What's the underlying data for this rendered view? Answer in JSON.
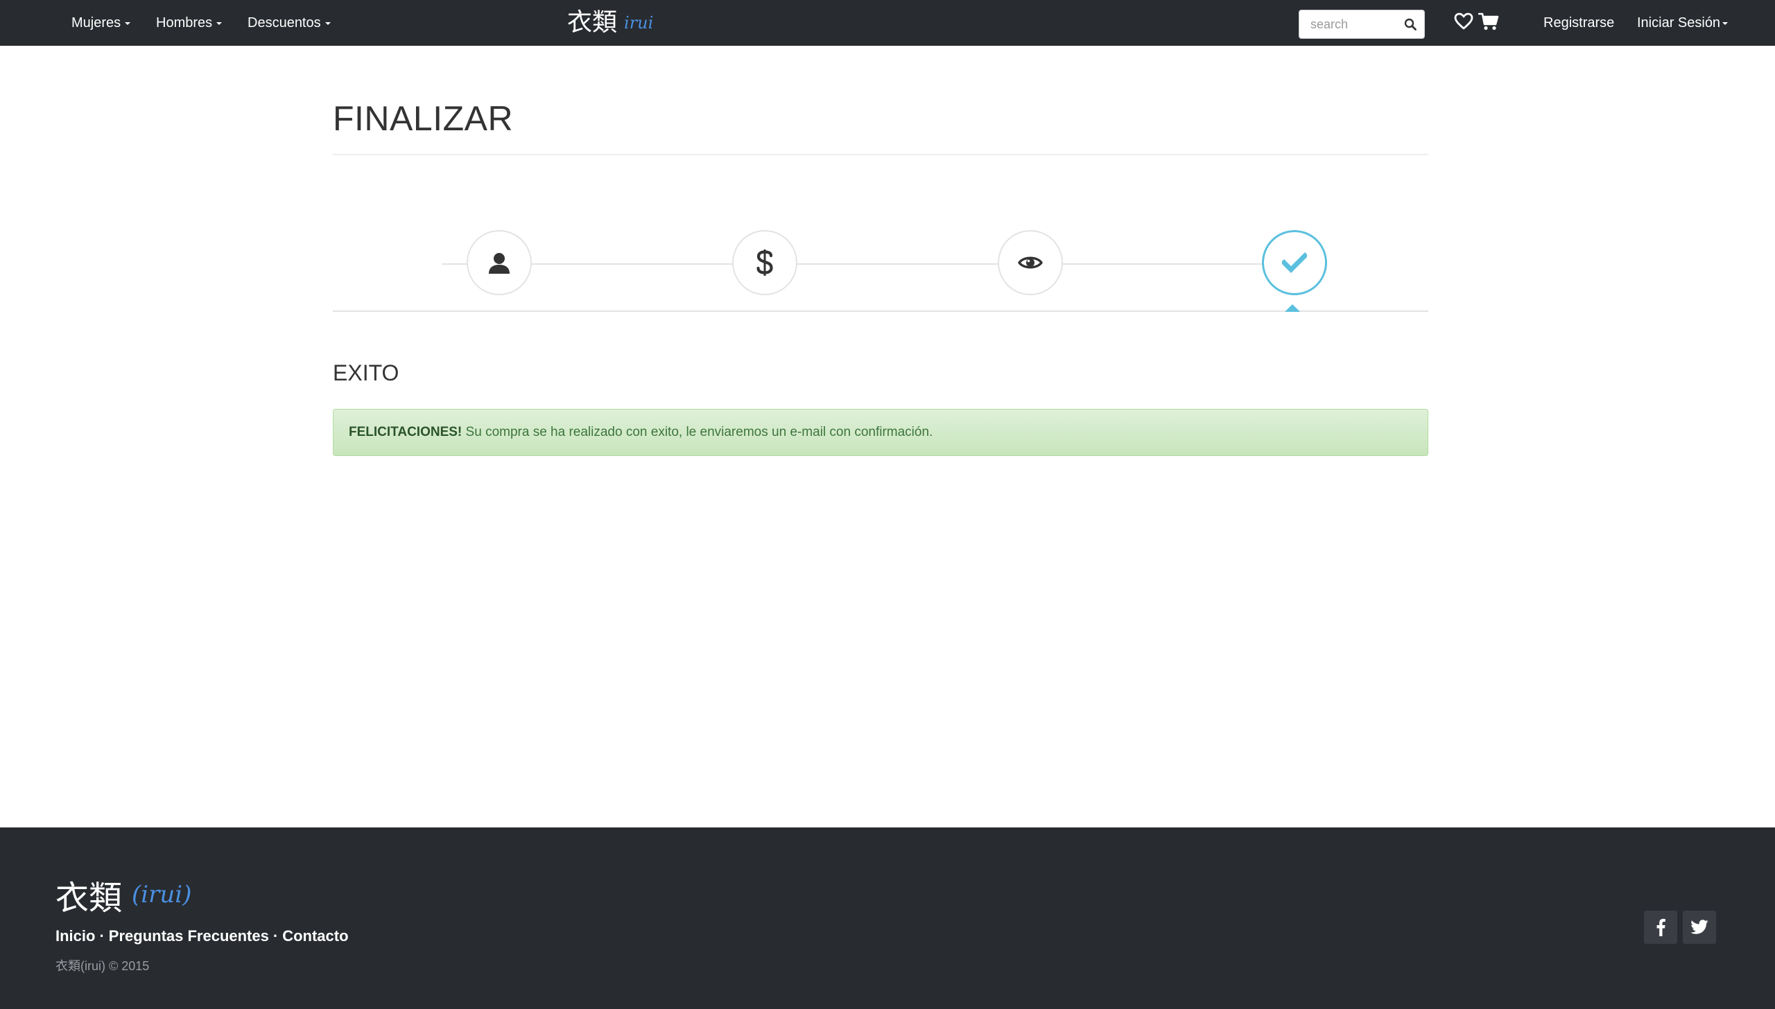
{
  "header": {
    "nav_items": [
      {
        "label": "Mujeres"
      },
      {
        "label": "Hombres"
      },
      {
        "label": "Descuentos"
      }
    ],
    "brand_kanji": "衣類",
    "brand_roman": "irui",
    "search_placeholder": "search",
    "register_label": "Registrarse",
    "login_label": "Iniciar Sesión"
  },
  "main": {
    "title": "FINALIZAR",
    "steps": [
      {
        "icon": "user-icon",
        "active": false
      },
      {
        "icon": "dollar-icon",
        "active": false
      },
      {
        "icon": "eye-icon",
        "active": false
      },
      {
        "icon": "check-icon",
        "active": true
      }
    ],
    "section_title": "EXITO",
    "alert": {
      "strong": "FELICITACIONES!",
      "message": " Su compra se ha realizado con exito, le enviaremos un e-mail con confirmación."
    }
  },
  "footer": {
    "brand_kanji": "衣類",
    "brand_roman": "(irui)",
    "links": [
      {
        "label": "Inicio"
      },
      {
        "label": "Preguntas Frecuentes"
      },
      {
        "label": "Contacto"
      }
    ],
    "separator": "·",
    "copyright": "衣類(irui) © 2015"
  },
  "colors": {
    "navbar_bg": "#282b30",
    "accent": "#5bc0de",
    "brand_blue": "#4a90e2",
    "success_bg": "#dff0d8",
    "success_text": "#3c763d"
  }
}
